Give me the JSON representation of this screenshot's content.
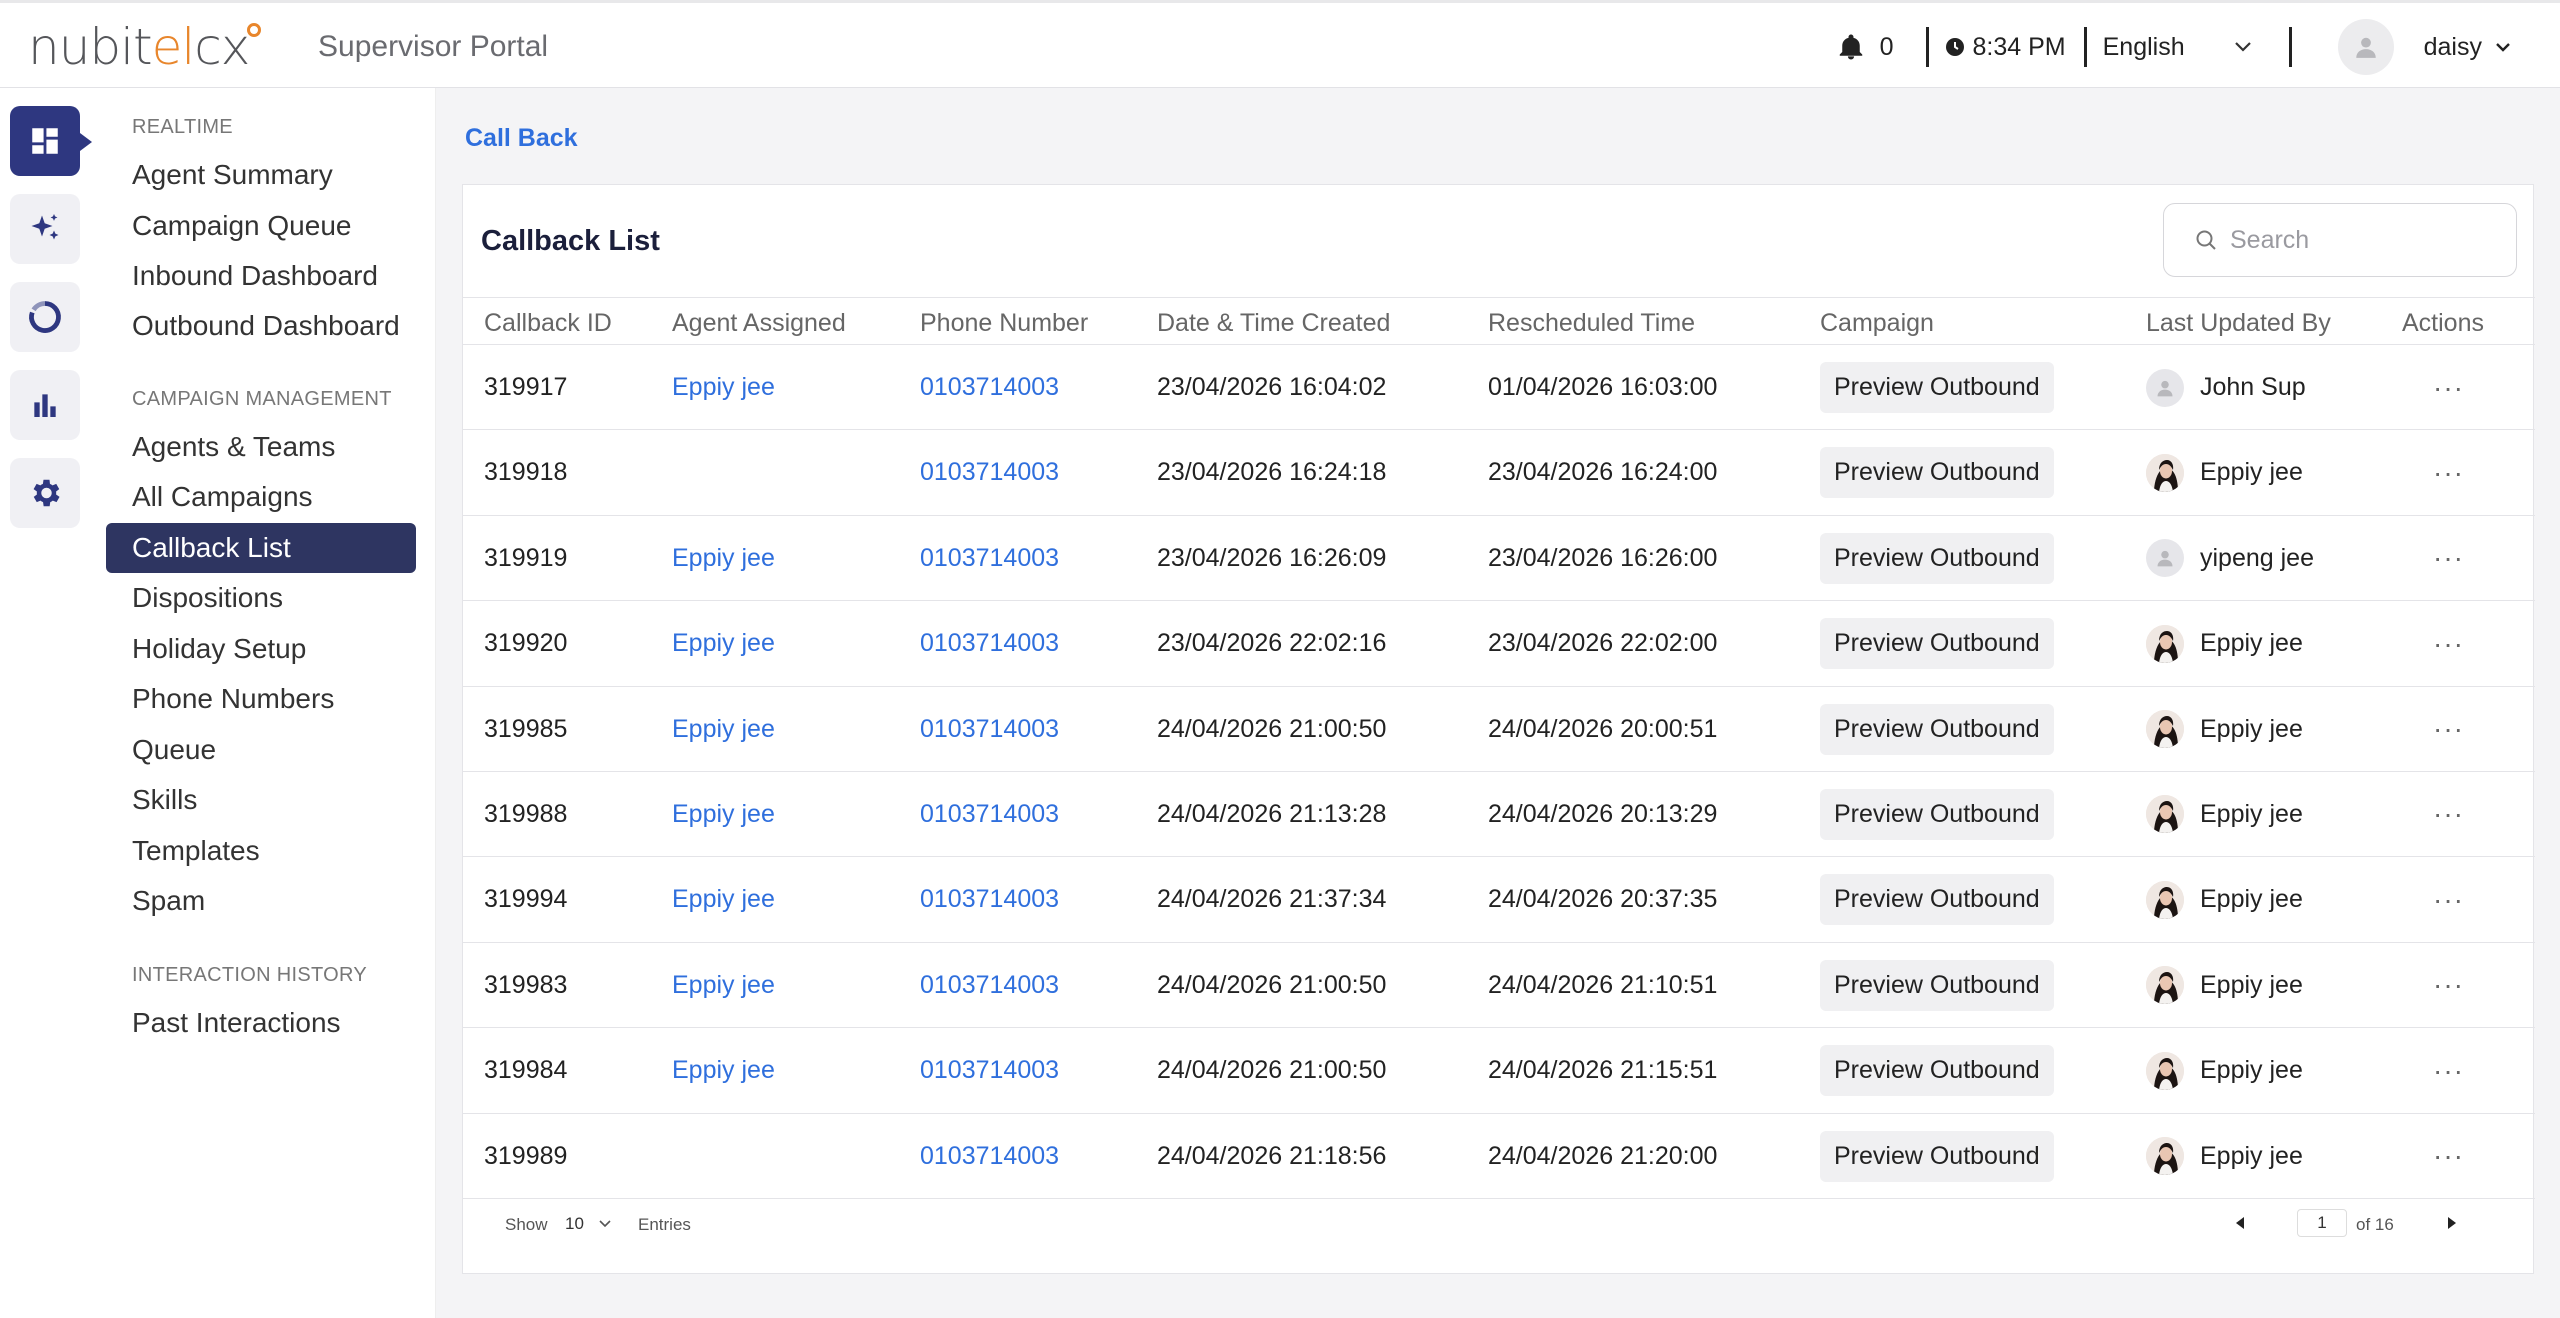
{
  "header": {
    "logo": {
      "part1": "nubit",
      "part2": "el",
      "part3": "cx"
    },
    "portal_title": "Supervisor Portal",
    "notification_count": "0",
    "time": "8:34 PM",
    "language": "English",
    "username": "daisy"
  },
  "rail": {
    "icons": [
      "dashboard-icon",
      "sparkle-icon",
      "donut-chart-icon",
      "bar-chart-icon",
      "gear-icon"
    ],
    "active": "dashboard-icon"
  },
  "sidebar": {
    "sections": [
      {
        "title": "REALTIME",
        "items": [
          "Agent Summary",
          "Campaign Queue",
          "Inbound Dashboard",
          "Outbound Dashboard"
        ]
      },
      {
        "title": "CAMPAIGN MANAGEMENT",
        "items": [
          "Agents & Teams",
          "All Campaigns",
          "Callback List",
          "Dispositions",
          "Holiday Setup",
          "Phone Numbers",
          "Queue",
          "Skills",
          "Templates",
          "Spam"
        ]
      },
      {
        "title": "INTERACTION HISTORY",
        "items": [
          "Past Interactions"
        ]
      }
    ],
    "active_item": "Callback List"
  },
  "breadcrumb": "Call Back",
  "card": {
    "title": "Callback List",
    "search_placeholder": "Search"
  },
  "table": {
    "columns": [
      "Callback ID",
      "Agent Assigned",
      "Phone Number",
      "Date & Time Created",
      "Rescheduled Time",
      "Campaign",
      "Last Updated By",
      "Actions"
    ],
    "rows": [
      {
        "id": "319917",
        "agent": "Eppiy jee",
        "phone": "0103714003",
        "created": "23/04/2026 16:04:02",
        "rescheduled": "01/04/2026 16:03:00",
        "campaign": "Preview Outbound",
        "updated_by": "John Sup",
        "avatar": "generic",
        "actions": "···"
      },
      {
        "id": "319918",
        "agent": "",
        "phone": "0103714003",
        "created": "23/04/2026 16:24:18",
        "rescheduled": "23/04/2026 16:24:00",
        "campaign": "Preview Outbound",
        "updated_by": "Eppiy jee",
        "avatar": "photo",
        "actions": "···"
      },
      {
        "id": "319919",
        "agent": "Eppiy jee",
        "phone": "0103714003",
        "created": "23/04/2026 16:26:09",
        "rescheduled": "23/04/2026 16:26:00",
        "campaign": "Preview Outbound",
        "updated_by": "yipeng jee",
        "avatar": "generic",
        "actions": "···"
      },
      {
        "id": "319920",
        "agent": "Eppiy jee",
        "phone": "0103714003",
        "created": "23/04/2026 22:02:16",
        "rescheduled": "23/04/2026 22:02:00",
        "campaign": "Preview Outbound",
        "updated_by": "Eppiy jee",
        "avatar": "photo",
        "actions": "···"
      },
      {
        "id": "319985",
        "agent": "Eppiy jee",
        "phone": "0103714003",
        "created": "24/04/2026 21:00:50",
        "rescheduled": "24/04/2026 20:00:51",
        "campaign": "Preview Outbound",
        "updated_by": "Eppiy jee",
        "avatar": "photo",
        "actions": "···"
      },
      {
        "id": "319988",
        "agent": "Eppiy jee",
        "phone": "0103714003",
        "created": "24/04/2026 21:13:28",
        "rescheduled": "24/04/2026 20:13:29",
        "campaign": "Preview Outbound",
        "updated_by": "Eppiy jee",
        "avatar": "photo",
        "actions": "···"
      },
      {
        "id": "319994",
        "agent": "Eppiy jee",
        "phone": "0103714003",
        "created": "24/04/2026 21:37:34",
        "rescheduled": "24/04/2026 20:37:35",
        "campaign": "Preview Outbound",
        "updated_by": "Eppiy jee",
        "avatar": "photo",
        "actions": "···"
      },
      {
        "id": "319983",
        "agent": "Eppiy jee",
        "phone": "0103714003",
        "created": "24/04/2026 21:00:50",
        "rescheduled": "24/04/2026 21:10:51",
        "campaign": "Preview Outbound",
        "updated_by": "Eppiy jee",
        "avatar": "photo",
        "actions": "···"
      },
      {
        "id": "319984",
        "agent": "Eppiy jee",
        "phone": "0103714003",
        "created": "24/04/2026 21:00:50",
        "rescheduled": "24/04/2026 21:15:51",
        "campaign": "Preview Outbound",
        "updated_by": "Eppiy jee",
        "avatar": "photo",
        "actions": "···"
      },
      {
        "id": "319989",
        "agent": "",
        "phone": "0103714003",
        "created": "24/04/2026 21:18:56",
        "rescheduled": "24/04/2026 21:20:00",
        "campaign": "Preview Outbound",
        "updated_by": "Eppiy jee",
        "avatar": "photo",
        "actions": "···"
      }
    ]
  },
  "footer": {
    "show_label": "Show",
    "page_size": "10",
    "entries_label": "Entries",
    "current_page": "1",
    "total_pages_label": "of 16"
  },
  "colors": {
    "brand_navy": "#2e3780",
    "active_nav": "#2e3561",
    "link_blue": "#2f6fdd",
    "logo_orange": "#e8862c"
  }
}
